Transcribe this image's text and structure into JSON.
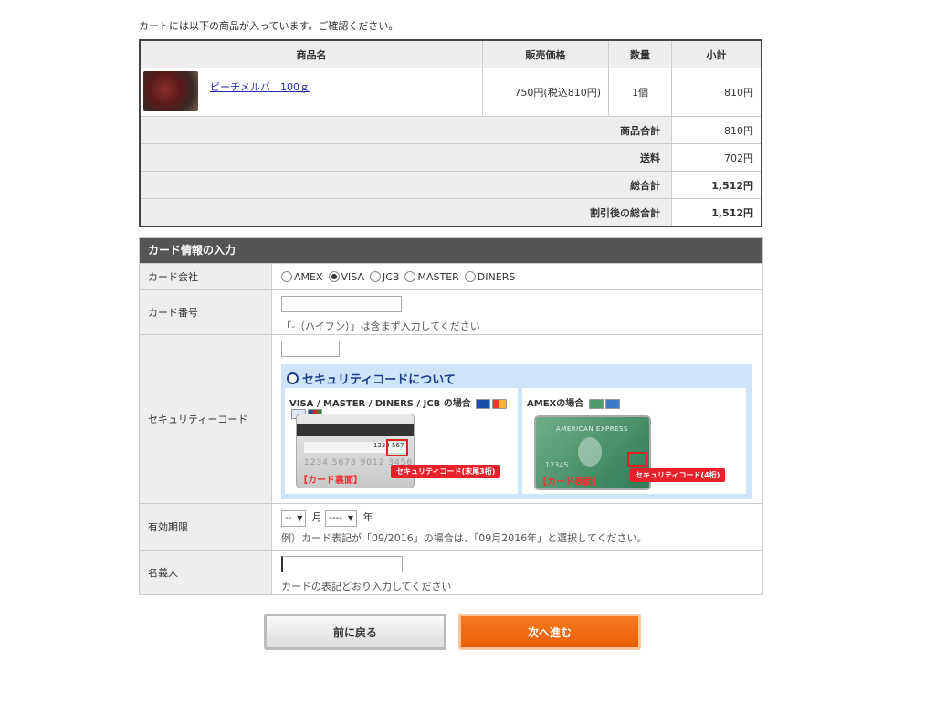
{
  "intro": "カートには以下の商品が入っています。ご確認ください。",
  "cart": {
    "headers": [
      "商品名",
      "販売価格",
      "数量",
      "小計"
    ],
    "item": {
      "name": "ピーチメルバ　100ｇ",
      "price": "750円(税込810円)",
      "qty": "1個",
      "subtotal": "810円"
    },
    "summary": [
      {
        "label": "商品合計",
        "value": "810円"
      },
      {
        "label": "送料",
        "value": "702円"
      },
      {
        "label": "総合計",
        "value": "1,512円"
      },
      {
        "label": "割引後の総合計",
        "value": "1,512円"
      }
    ]
  },
  "card_form": {
    "title": "カード情報の入力",
    "company_label": "カード会社",
    "companies": [
      "AMEX",
      "VISA",
      "JCB",
      "MASTER",
      "DINERS"
    ],
    "selected_company": "VISA",
    "number_label": "カード番号",
    "number_note": "「-（ハイフン）」は含まず入力してください",
    "security_label": "セキュリティーコード",
    "security_title": "セキュリティコードについて",
    "panel1_title": "VISA / MASTER / DINERS / JCB の場合",
    "panel1_code_sample": "1234 567",
    "panel1_numbers": "1234  5678  9012  3456",
    "panel1_side": "【カード裏面】",
    "panel1_tag": "セキュリティコード(末尾3桁)",
    "panel2_title": "AMEXの場合",
    "panel2_brand": "AMERICAN EXPRESS",
    "panel2_numbers": "12345",
    "panel2_side": "【カード表面】",
    "panel2_tag": "セキュリティコード(4桁)",
    "expiry_label": "有効期限",
    "month_value": "--",
    "month_unit": "月",
    "year_value": "----",
    "year_unit": "年",
    "expiry_note": "例）カード表記が「09/2016」の場合は、「09月2016年」と選択してください。",
    "holder_label": "名義人",
    "holder_note": "カードの表記どおり入力してください"
  },
  "buttons": {
    "back": "前に戻る",
    "next": "次へ進む"
  },
  "colors": {
    "header_bg": "#555555",
    "next_button": "#f06c12",
    "link": "#2a2aaa"
  }
}
